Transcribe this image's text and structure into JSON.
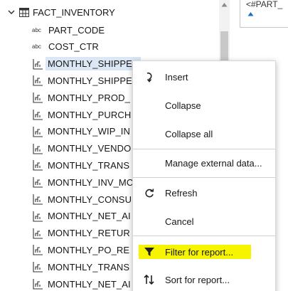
{
  "tree": {
    "root_label": "FACT_INVENTORY",
    "rows": [
      {
        "label": "PART_CODE",
        "icon": "abc"
      },
      {
        "label": "COST_CTR",
        "icon": "abc"
      },
      {
        "label": "MONTHLY_SHIPPED",
        "icon": "measure-icon",
        "selected": true
      },
      {
        "label": "MONTHLY_SHIPPE",
        "icon": "measure-icon"
      },
      {
        "label": "MONTHLY_PROD_",
        "icon": "measure-icon"
      },
      {
        "label": "MONTHLY_PURCH",
        "icon": "measure-icon"
      },
      {
        "label": "MONTHLY_WIP_IN",
        "icon": "measure-icon"
      },
      {
        "label": "MONTHLY_VENDO",
        "icon": "measure-icon"
      },
      {
        "label": "MONTHLY_TRANS",
        "icon": "measure-icon"
      },
      {
        "label": "MONTHLY_INV_MC",
        "icon": "measure-icon"
      },
      {
        "label": "MONTHLY_CONSU",
        "icon": "measure-icon"
      },
      {
        "label": "MONTHLY_NET_AI",
        "icon": "measure-icon"
      },
      {
        "label": "MONTHLY_RETUR",
        "icon": "measure-icon"
      },
      {
        "label": "MONTHLY_PO_RE",
        "icon": "measure-icon"
      },
      {
        "label": "MONTHLY_TRANS",
        "icon": "measure-icon"
      },
      {
        "label": "MONTHLY_NET_AI",
        "icon": "measure-icon"
      }
    ],
    "abc_text": "abc"
  },
  "expression": {
    "text": "<#PART_"
  },
  "context_menu": {
    "items": [
      {
        "label": "Insert",
        "icon": "insert-icon"
      },
      {
        "label": "Collapse",
        "icon": ""
      },
      {
        "label": "Collapse all",
        "icon": ""
      },
      {
        "label": "Manage external data...",
        "icon": ""
      },
      {
        "label": "Refresh",
        "icon": "refresh-icon"
      },
      {
        "label": "Cancel",
        "icon": ""
      },
      {
        "label": "Filter for report...",
        "icon": "filter-icon",
        "highlighted": true
      },
      {
        "label": "Sort for report...",
        "icon": "sort-icon"
      }
    ]
  },
  "colors": {
    "selection": "#dbe7f5",
    "highlight": "#f7f400",
    "scroll_track": "#f2f2f2",
    "scroll_thumb": "#c8c8c8",
    "accent_blue": "#1f70c1"
  }
}
